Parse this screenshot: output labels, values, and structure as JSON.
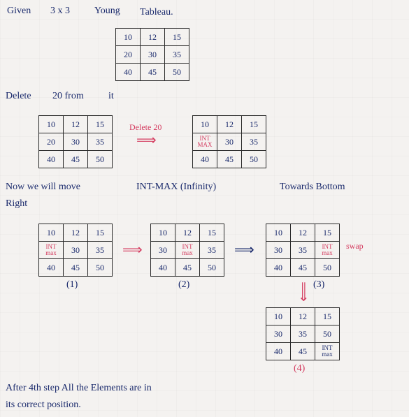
{
  "title": {
    "l1": "Given",
    "l2": "3 x 3",
    "l3": "Young",
    "l4": "Tableau."
  },
  "t_given": {
    "r0": [
      "10",
      "12",
      "15"
    ],
    "r1": [
      "20",
      "30",
      "35"
    ],
    "r2": [
      "40",
      "45",
      "50"
    ]
  },
  "delete_line": {
    "a": "Delete",
    "b": "20 from",
    "c": "it"
  },
  "t_left1": {
    "r0": [
      "10",
      "12",
      "15"
    ],
    "r1": [
      "20",
      "30",
      "35"
    ],
    "r2": [
      "40",
      "45",
      "50"
    ]
  },
  "del_arrow": "Delete 20",
  "t_right1": {
    "r0": [
      "10",
      "12",
      "15"
    ],
    "r1": [
      "INT\nMAX",
      "30",
      "35"
    ],
    "r2": [
      "40",
      "45",
      "50"
    ]
  },
  "note": {
    "a": "Now we will move",
    "b": "INT-MAX (Infinity)",
    "c": "Towards Bottom",
    "d": "Right"
  },
  "t_s1": {
    "r0": [
      "10",
      "12",
      "15"
    ],
    "r1": [
      "INT\nmax",
      "30",
      "35"
    ],
    "r2": [
      "40",
      "45",
      "50"
    ]
  },
  "s1_label": "(1)",
  "t_s2": {
    "r0": [
      "10",
      "12",
      "15"
    ],
    "r1": [
      "30",
      "INT\nmax",
      "35"
    ],
    "r2": [
      "40",
      "45",
      "50"
    ]
  },
  "s2_label": "(2)",
  "t_s3": {
    "r0": [
      "10",
      "12",
      "15"
    ],
    "r1": [
      "30",
      "35",
      "INT\nmax"
    ],
    "r2": [
      "40",
      "45",
      "50"
    ]
  },
  "s3_label": "(3)",
  "swap": "swap",
  "t_s4": {
    "r0": [
      "10",
      "12",
      "15"
    ],
    "r1": [
      "30",
      "35",
      "50"
    ],
    "r2": [
      "40",
      "45",
      "INT\nmax"
    ]
  },
  "s4_label": "(4)",
  "concl": {
    "a": "After 4th step All the Elements are in",
    "b": "its correct position."
  }
}
